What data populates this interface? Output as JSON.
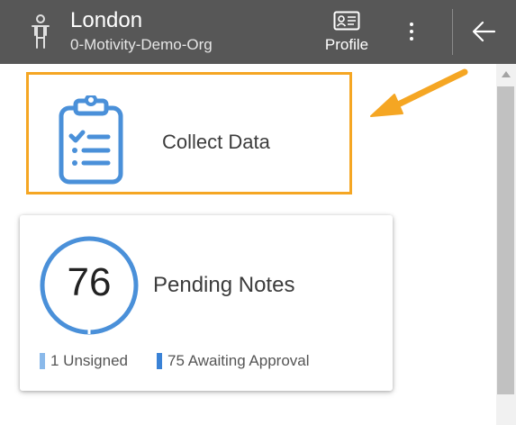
{
  "header": {
    "title": "London",
    "subtitle": "0-Motivity-Demo-Org",
    "profile_label": "Profile",
    "icons": [
      "person-icon",
      "id-card-icon",
      "more-vertical-icon",
      "arrow-left-icon"
    ]
  },
  "collect_data": {
    "label": "Collect Data",
    "icon": "clipboard-checklist-icon",
    "highlight_color": "#f5a623"
  },
  "pending_notes": {
    "count": "76",
    "label": "Pending Notes",
    "ring_color": "#4a90d9",
    "legend": [
      {
        "label": "1 Unsigned",
        "color": "#8ab9ea"
      },
      {
        "label": "75 Awaiting Approval",
        "color": "#3a82d6"
      }
    ]
  },
  "annotation": {
    "arrow_color": "#f5a623",
    "points_to": "collect_data"
  },
  "colors": {
    "header_bg": "#575757",
    "accent_blue": "#4a90d9",
    "highlight": "#f5a623"
  }
}
